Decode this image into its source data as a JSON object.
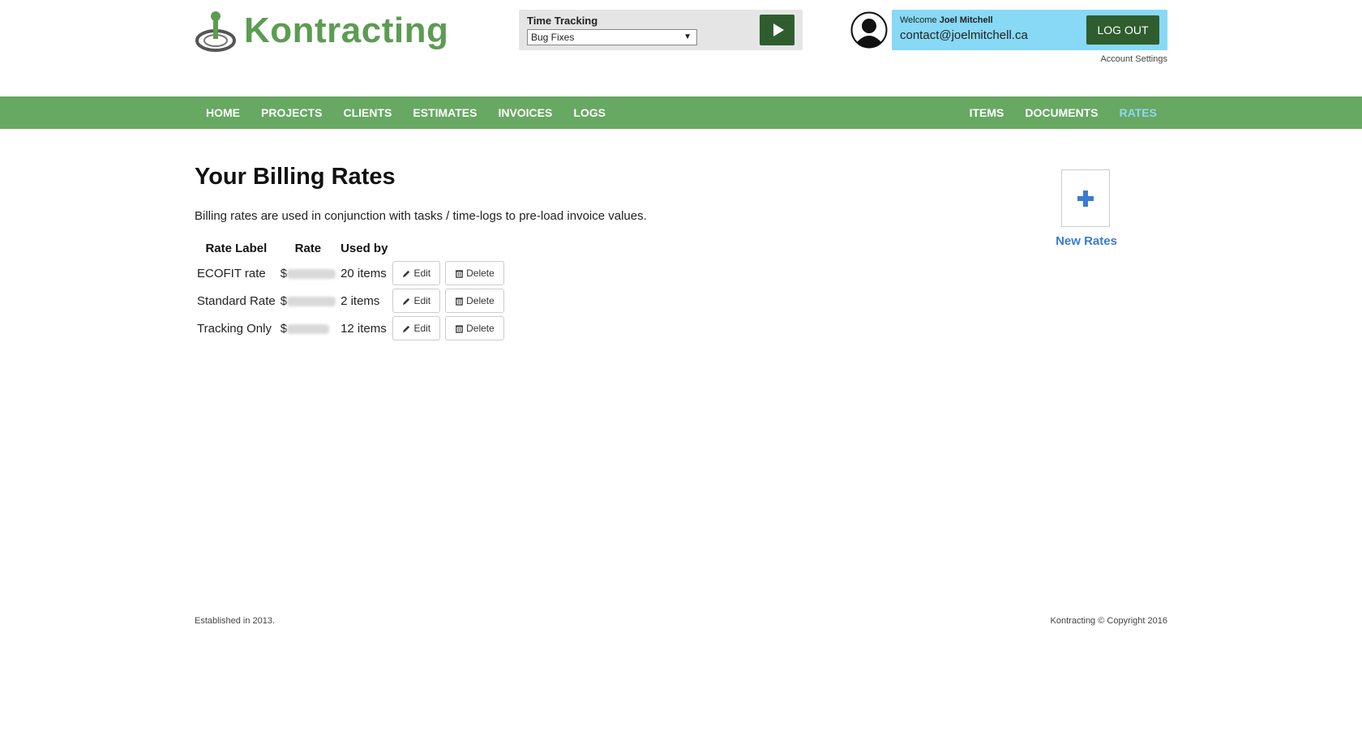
{
  "brand": {
    "name": "Kontracting",
    "color": "#5c9c52"
  },
  "tracker": {
    "label": "Time Tracking",
    "selected": "Bug Fixes",
    "caret": "▼"
  },
  "user": {
    "welcome": "Welcome",
    "name": "Joel Mitchell",
    "email": "contact@joelmitchell.ca",
    "logout": "LOG OUT",
    "account_settings": "Account Settings"
  },
  "nav": {
    "left": [
      "HOME",
      "PROJECTS",
      "CLIENTS",
      "ESTIMATES",
      "INVOICES",
      "LOGS"
    ],
    "right": [
      "ITEMS",
      "DOCUMENTS",
      "RATES"
    ],
    "active": "RATES",
    "active_color": "#8fd7f2",
    "bar_color": "#67a862"
  },
  "page": {
    "title": "Your Billing Rates",
    "description": "Billing rates are used in conjunction with tasks / time-logs to pre-load invoice values."
  },
  "table": {
    "headers": [
      "Rate Label",
      "Rate",
      "Used by"
    ],
    "rows": [
      {
        "label": "ECOFIT rate",
        "rate_prefix": "$",
        "used_by": "20 items"
      },
      {
        "label": "Standard Rate",
        "rate_prefix": "$",
        "used_by": "2 items"
      },
      {
        "label": "Tracking Only",
        "rate_prefix": "$",
        "used_by": "12 items"
      }
    ],
    "edit_label": "Edit",
    "delete_label": "Delete"
  },
  "new_rates": {
    "label": "New Rates",
    "color": "#3a7bd5"
  },
  "footer": {
    "left": "Established in 2013.",
    "right": "Kontracting © Copyright 2016"
  }
}
